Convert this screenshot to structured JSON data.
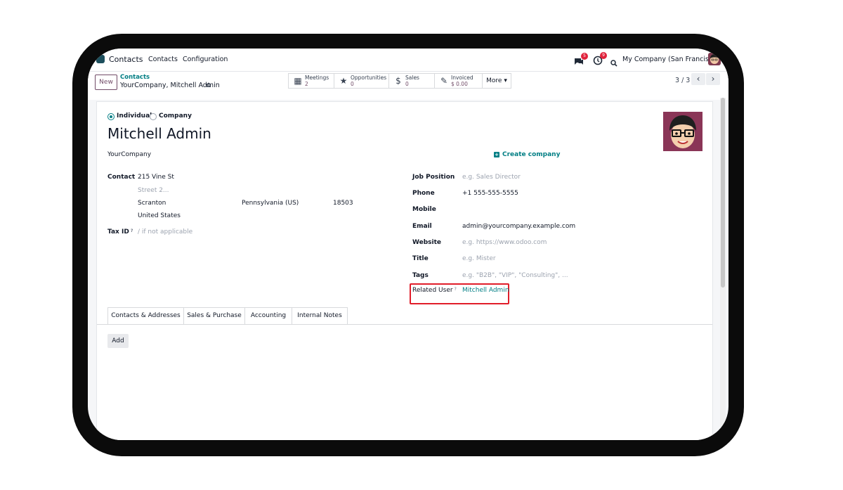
{
  "topbar": {
    "app_name": "Contacts",
    "menu": [
      "Contacts",
      "Configuration"
    ],
    "chat_count": "5",
    "activity_count": "9",
    "company": "My Company (San Francisco)"
  },
  "control_panel": {
    "new_label": "New",
    "breadcrumb_parent": "Contacts",
    "breadcrumb_current": "YourCompany, Mitchell Admin",
    "smart_buttons": [
      {
        "label": "Meetings",
        "value": "2",
        "icon": "calendar-icon"
      },
      {
        "label": "Opportunities",
        "value": "0",
        "icon": "star-icon"
      },
      {
        "label": "Sales",
        "value": "0",
        "icon": "dollar-icon"
      },
      {
        "label": "Invoiced",
        "value": "$ 0.00",
        "icon": "invoice-icon"
      }
    ],
    "more_label": "More",
    "pager": "3 / 3"
  },
  "form": {
    "type_options": [
      "Individual",
      "Company"
    ],
    "selected_type": "Individual",
    "name": "Mitchell Admin",
    "company": "YourCompany",
    "create_company_label": "Create company",
    "contact_label": "Contact",
    "street": "215 Vine St",
    "street2_placeholder": "Street 2...",
    "city": "Scranton",
    "state": "Pennsylvania (US)",
    "zip": "18503",
    "country": "United States",
    "tax_id_label": "Tax ID",
    "tax_id_help": "?",
    "tax_id_placeholder": "/ if not applicable",
    "job_position_label": "Job Position",
    "job_position_placeholder": "e.g. Sales Director",
    "phone_label": "Phone",
    "phone": "+1 555-555-5555",
    "mobile_label": "Mobile",
    "email_label": "Email",
    "email": "admin@yourcompany.example.com",
    "website_label": "Website",
    "website_placeholder": "e.g. https://www.odoo.com",
    "title_label": "Title",
    "title_placeholder": "e.g. Mister",
    "tags_label": "Tags",
    "tags_placeholder": "e.g. \"B2B\", \"VIP\", \"Consulting\", ...",
    "related_user_label": "Related User",
    "related_user_help": "?",
    "related_user": "Mitchell Admin"
  },
  "tabs": [
    "Contacts & Addresses",
    "Sales & Purchase",
    "Accounting",
    "Internal Notes"
  ],
  "add_label": "Add",
  "colors": {
    "brand": "#714b67",
    "link": "#017e84",
    "highlight": "#e11d2a"
  }
}
